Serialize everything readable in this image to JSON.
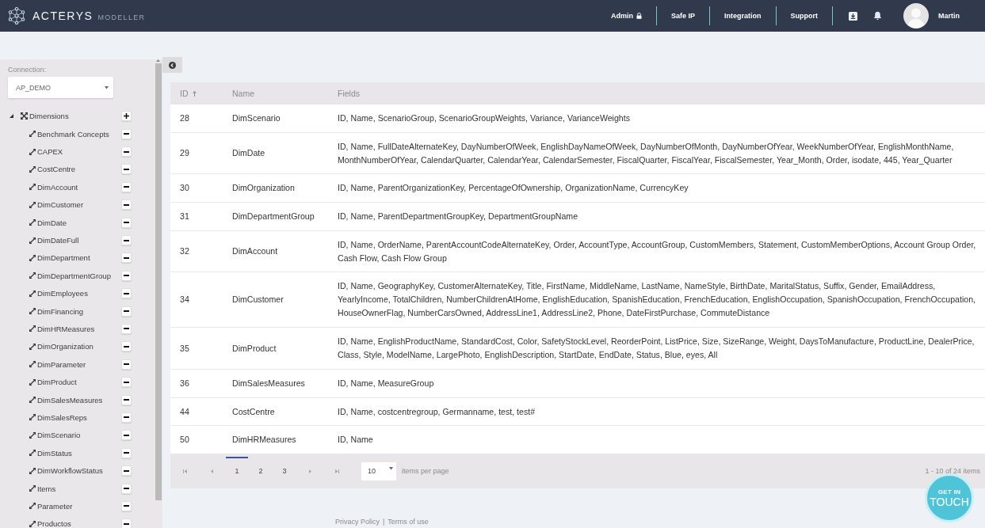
{
  "header": {
    "logo": {
      "name": "ACTERYS",
      "product": "MODELLER"
    },
    "nav": [
      {
        "label": "Admin",
        "locked": true
      },
      {
        "label": "Safe IP",
        "locked": false
      },
      {
        "label": "Integration",
        "locked": false
      },
      {
        "label": "Support",
        "locked": false
      }
    ],
    "user": {
      "name": "Martin"
    }
  },
  "sidebar": {
    "connection": {
      "label": "Connection:",
      "value": "AP_DEMO"
    },
    "tree": [
      {
        "label": "Dimensions",
        "expanded": true,
        "kind": "add",
        "children": [
          {
            "label": "Benchmark Concepts",
            "kind": "remove"
          },
          {
            "label": "CAPEX",
            "kind": "remove"
          },
          {
            "label": "CostCentre",
            "kind": "remove"
          },
          {
            "label": "DimAccount",
            "kind": "remove"
          },
          {
            "label": "DimCustomer",
            "kind": "remove"
          },
          {
            "label": "DimDate",
            "kind": "remove"
          },
          {
            "label": "DimDateFull",
            "kind": "remove"
          },
          {
            "label": "DimDepartment",
            "kind": "remove"
          },
          {
            "label": "DimDepartmentGroup",
            "kind": "remove"
          },
          {
            "label": "DimEmployees",
            "kind": "remove"
          },
          {
            "label": "DimFinancing",
            "kind": "remove"
          },
          {
            "label": "DimHRMeasures",
            "kind": "remove"
          },
          {
            "label": "DimOrganization",
            "kind": "remove"
          },
          {
            "label": "DimParameter",
            "kind": "remove"
          },
          {
            "label": "DimProduct",
            "kind": "remove"
          },
          {
            "label": "DimSalesMeasures",
            "kind": "remove"
          },
          {
            "label": "DimSalesReps",
            "kind": "remove"
          },
          {
            "label": "DimScenario",
            "kind": "remove"
          },
          {
            "label": "DimStatus",
            "kind": "remove"
          },
          {
            "label": "DimWorkflowStatus",
            "kind": "remove"
          },
          {
            "label": "Items",
            "kind": "remove"
          },
          {
            "label": "Parameter",
            "kind": "remove"
          },
          {
            "label": "Productos",
            "kind": "remove"
          }
        ]
      }
    ]
  },
  "table": {
    "columns": [
      {
        "label": "ID",
        "sorted": true
      },
      {
        "label": "Name",
        "sorted": false
      },
      {
        "label": "Fields",
        "sorted": false
      }
    ],
    "rows": [
      {
        "id": "28",
        "name": "DimScenario",
        "fields": "ID, Name, ScenarioGroup, ScenarioGroupWeights, Variance, VarianceWeights"
      },
      {
        "id": "29",
        "name": "DimDate",
        "fields": "ID, Name, FullDateAlternateKey, DayNumberOfWeek, EnglishDayNameOfWeek, DayNumberOfMonth, DayNumberOfYear, WeekNumberOfYear, EnglishMonthName, MonthNumberOfYear, CalendarQuarter, CalendarYear, CalendarSemester, FiscalQuarter, FiscalYear, FiscalSemester, Year_Month, Order, isodate, 445, Year_Quarter"
      },
      {
        "id": "30",
        "name": "DimOrganization",
        "fields": "ID, Name, ParentOrganizationKey, PercentageOfOwnership, OrganizationName, CurrencyKey"
      },
      {
        "id": "31",
        "name": "DimDepartmentGroup",
        "fields": "ID, Name, ParentDepartmentGroupKey, DepartmentGroupName"
      },
      {
        "id": "32",
        "name": "DimAccount",
        "fields": "ID, Name, OrderName, ParentAccountCodeAlternateKey, Order, AccountType, AccountGroup, CustomMembers, Statement, CustomMemberOptions, Account Group Order, Cash Flow, Cash Flow Group"
      },
      {
        "id": "34",
        "name": "DimCustomer",
        "fields": "ID, Name, GeographyKey, CustomerAlternateKey, Title, FirstName, MiddleName, LastName, NameStyle, BirthDate, MaritalStatus, Suffix, Gender, EmailAddress, YearlyIncome, TotalChildren, NumberChildrenAtHome, EnglishEducation, SpanishEducation, FrenchEducation, EnglishOccupation, SpanishOccupation, FrenchOccupation, HouseOwnerFlag, NumberCarsOwned, AddressLine1, AddressLine2, Phone, DateFirstPurchase, CommuteDistance"
      },
      {
        "id": "35",
        "name": "DimProduct",
        "fields": "ID, Name, EnglishProductName, StandardCost, Color, SafetyStockLevel, ReorderPoint, ListPrice, Size, SizeRange, Weight, DaysToManufacture, ProductLine, DealerPrice, Class, Style, ModelName, LargePhoto, EnglishDescription, StartDate, EndDate, Status, Blue, eyes, All"
      },
      {
        "id": "36",
        "name": "DimSalesMeasures",
        "fields": "ID, Name, MeasureGroup"
      },
      {
        "id": "44",
        "name": "CostCentre",
        "fields": "ID, Name, costcentregroup, Germanname, test, test#"
      },
      {
        "id": "50",
        "name": "DimHRMeasures",
        "fields": "ID, Name"
      }
    ]
  },
  "pagination": {
    "pages": [
      {
        "label": "1",
        "selected": true
      },
      {
        "label": "2",
        "selected": false
      },
      {
        "label": "3",
        "selected": false
      }
    ],
    "page_size": "10",
    "page_size_label": "items per page",
    "summary": "1 - 10 of 24 items"
  },
  "contact_badge": {
    "line_1": "GET IN",
    "line_2": "TOUCH"
  },
  "footer": {
    "links": [
      "Privacy Policy",
      "Terms of use"
    ],
    "separator": "|"
  }
}
